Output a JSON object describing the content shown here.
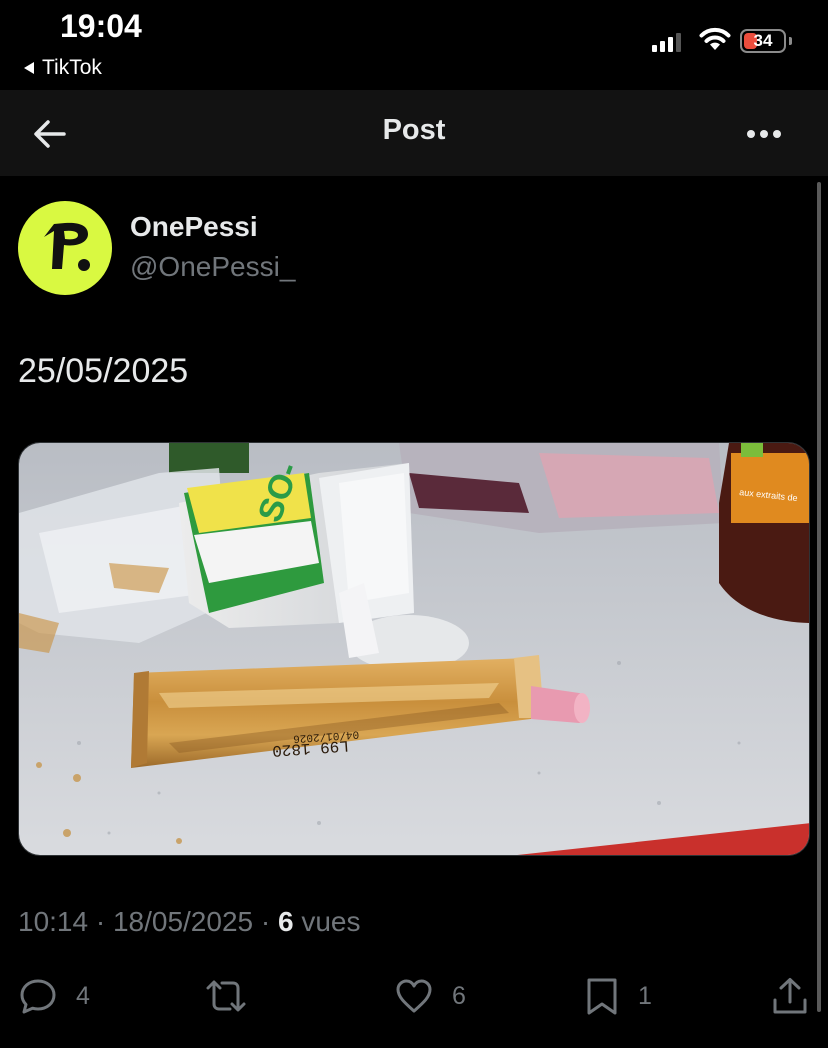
{
  "status_bar": {
    "time": "19:04",
    "back_app": "TikTok",
    "battery": "34",
    "battery_level": 0.34,
    "signal_bars": 3,
    "icons": [
      "cellular-signal-icon",
      "wifi-icon",
      "battery-charging-icon"
    ]
  },
  "nav": {
    "title": "Post",
    "icons": [
      "back-arrow-icon",
      "more-options-icon"
    ]
  },
  "post": {
    "author": {
      "name": "OnePessi",
      "handle": "@OnePessi_",
      "avatar_color": "#d9f941",
      "avatar_logo": "P"
    },
    "text": "25/05/2025",
    "media": {
      "print_code": "L99 1820",
      "print_date": "04/01/2026",
      "cup_brand": "SO-",
      "bottle_text": "aux extraits de"
    },
    "timestamp": "10:14 · 18/05/2025 · ",
    "views_count": "6",
    "views_label": " vues"
  },
  "actions": {
    "replies": "4",
    "reposts": "",
    "likes": "6",
    "bookmarks": "1",
    "icons": [
      "reply-icon",
      "repost-icon",
      "like-icon",
      "bookmark-icon",
      "share-icon"
    ]
  },
  "colors": {
    "background": "#000000",
    "header": "#121212",
    "text_primary": "#e7e9ea",
    "text_secondary": "#71767b",
    "accent_avatar": "#d9f941",
    "battery": "#eb4d3d"
  }
}
